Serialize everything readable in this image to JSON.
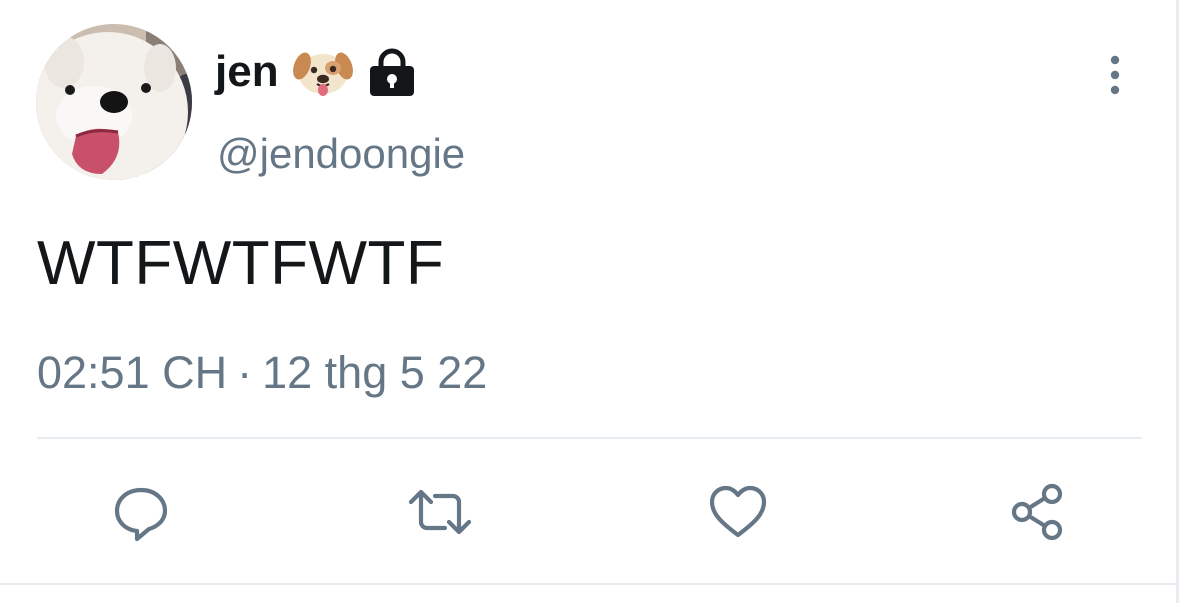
{
  "tweet": {
    "author": {
      "display_name": "jen",
      "handle": "@jendoongie",
      "name_emoji": "dog-face-emoji",
      "protected_icon": "lock-icon",
      "avatar": "avatar-samoyed-dog"
    },
    "text": "WTFWTFWTF",
    "time": "02:51 CH",
    "separator": "·",
    "date": "12 thg 5 22",
    "menu_icon": "more-vertical-icon"
  },
  "actions": [
    {
      "name": "reply",
      "icon": "reply-bubble-icon"
    },
    {
      "name": "retweet",
      "icon": "retweet-icon"
    },
    {
      "name": "like",
      "icon": "heart-icon"
    },
    {
      "name": "share",
      "icon": "share-icon"
    }
  ],
  "colors": {
    "text_primary": "#14171a",
    "text_secondary": "#657786",
    "divider": "#e6ecf0",
    "icon": "#657786"
  }
}
